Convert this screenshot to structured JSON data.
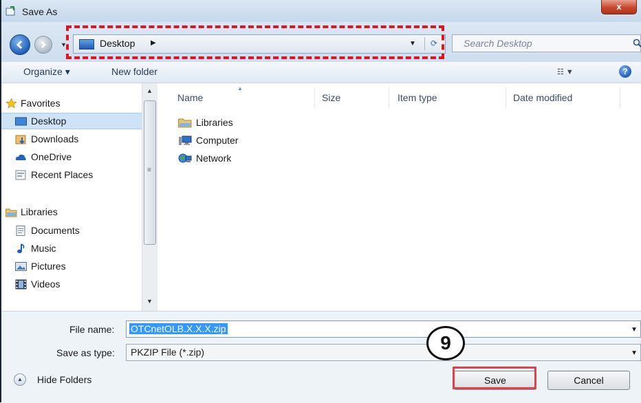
{
  "window": {
    "title": "Save As",
    "close_label": "x"
  },
  "navbar": {
    "location": "Desktop",
    "search_placeholder": "Search Desktop"
  },
  "toolbar": {
    "organize_label": "Organize ▾",
    "new_folder_label": "New folder",
    "view_icon": "views-icon",
    "help_label": "?"
  },
  "nav_pane": {
    "favorites_label": "Favorites",
    "favorites_items": [
      "Desktop",
      "Downloads",
      "OneDrive",
      "Recent Places"
    ],
    "libraries_label": "Libraries",
    "libraries_items": [
      "Documents",
      "Music",
      "Pictures",
      "Videos"
    ],
    "selected": "Desktop"
  },
  "file_list": {
    "columns": [
      "Name",
      "Size",
      "Item type",
      "Date modified"
    ],
    "items": [
      "Libraries",
      "Computer",
      "Network"
    ]
  },
  "form": {
    "file_name_label": "File name:",
    "file_name_value": "OTCnetOLB.X.X.X.zip",
    "save_type_label": "Save as type:",
    "save_type_value": "PKZIP File (*.zip)"
  },
  "footer": {
    "hide_folders_label": "Hide Folders",
    "save_label": "Save",
    "cancel_label": "Cancel"
  },
  "annotation": {
    "step_number": "9"
  },
  "colors": {
    "highlight_red": "#e0141e",
    "selection_blue": "#3399ff",
    "nav_selected": "#cfe3f7"
  }
}
